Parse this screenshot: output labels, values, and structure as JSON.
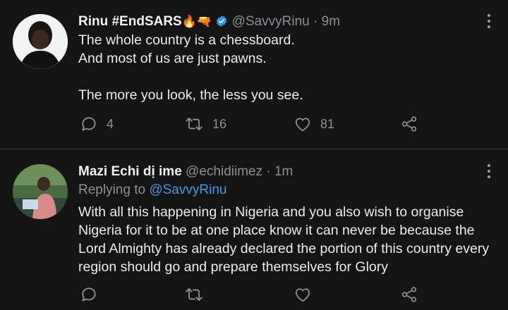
{
  "tweets": [
    {
      "display_name": "Rinu #EndSARS",
      "name_emojis": "🔥🔫",
      "verified": true,
      "handle": "@SavvyRinu",
      "separator": "·",
      "time": "9m",
      "lines": [
        "The whole country is a chessboard.",
        "And most of us are just pawns.",
        "The more you look, the less you see."
      ],
      "reply_count": "4",
      "retweet_count": "16",
      "like_count": "81"
    },
    {
      "display_name": "Mazi Echi dị ime",
      "verified": false,
      "handle": "@echidiimez",
      "separator": "·",
      "time": "1m",
      "replying_label": "Replying to",
      "replying_to": "@SavvyRinu",
      "text": "With all this happening in Nigeria and you also wish to organise Nigeria for it to be at one place know it can never be because the Lord Almighty has already declared the portion of this country every region should go and prepare themselves for Glory"
    }
  ],
  "colors": {
    "background": "#141414",
    "text": "#ececec",
    "muted": "#8a9097",
    "link": "#3c9be7",
    "verified": "#1d9bf0"
  },
  "icons": [
    "reply-icon",
    "retweet-icon",
    "like-icon",
    "share-icon",
    "more-options-icon",
    "verified-badge-icon"
  ]
}
